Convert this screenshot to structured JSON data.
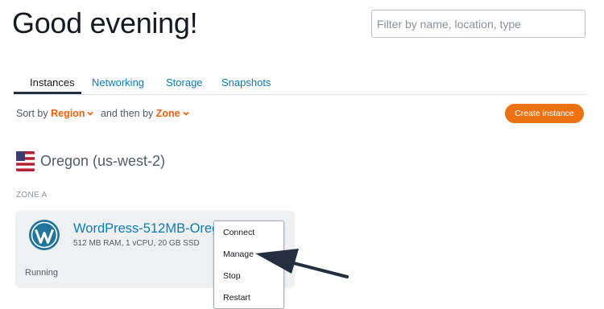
{
  "header": {
    "greeting": "Good evening!",
    "search_placeholder": "Filter by name, location, type"
  },
  "tabs": [
    {
      "label": "Instances",
      "active": true
    },
    {
      "label": "Networking",
      "active": false
    },
    {
      "label": "Storage",
      "active": false
    },
    {
      "label": "Snapshots",
      "active": false
    }
  ],
  "sort": {
    "prefix": "Sort by",
    "primary": "Region",
    "middle": "and then by",
    "secondary": "Zone"
  },
  "create_button_label": "Create instance",
  "region": {
    "name": "Oregon (us-west-2)",
    "flag_icon": "us-flag-icon",
    "zone_label": "ZONE A"
  },
  "instance": {
    "name": "WordPress-512MB-Oregon",
    "specs": "512 MB RAM, 1 vCPU, 20 GB SSD",
    "status": "Running",
    "logo_icon": "wordpress-icon"
  },
  "context_menu": {
    "items": [
      "Connect",
      "Manage",
      "Stop",
      "Restart"
    ]
  },
  "colors": {
    "accent_orange": "#ec7211",
    "link_blue": "#0a7cba",
    "wordpress_blue": "#21759b"
  }
}
